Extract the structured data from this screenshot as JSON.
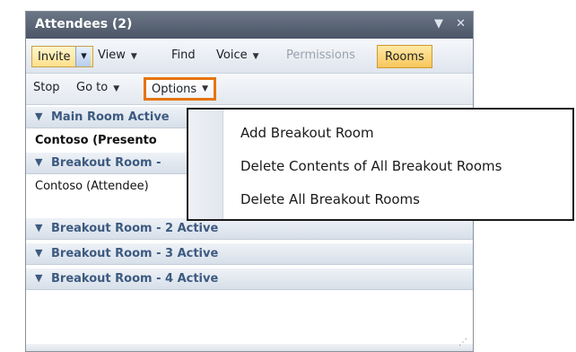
{
  "panel": {
    "title": "Attendees (2)",
    "pin_icon": "dropdown-arrow-icon",
    "close_icon": "close-icon"
  },
  "toolbar1": {
    "invite": "Invite",
    "view": "View",
    "find": "Find",
    "voice": "Voice",
    "permissions": "Permissions",
    "rooms": "Rooms"
  },
  "toolbar2": {
    "stop": "Stop",
    "goto": "Go to",
    "options": "Options"
  },
  "groups": {
    "main": {
      "label": "Main Room Active",
      "member": "Contoso (Presento"
    },
    "breakout1": {
      "label": "Breakout Room -",
      "member": "Contoso (Attendee)"
    },
    "breakout2": {
      "label": "Breakout Room - 2 Active"
    },
    "breakout3": {
      "label": "Breakout Room - 3 Active"
    },
    "breakout4": {
      "label": "Breakout Room - 4 Active"
    }
  },
  "menu": {
    "items": [
      "Add Breakout Room",
      "Delete Contents of All Breakout Rooms",
      "Delete All Breakout Rooms"
    ]
  },
  "colors": {
    "highlight_outline": "#e6740d",
    "group_text": "#3d5a80",
    "title_bar": "#5b6576"
  }
}
